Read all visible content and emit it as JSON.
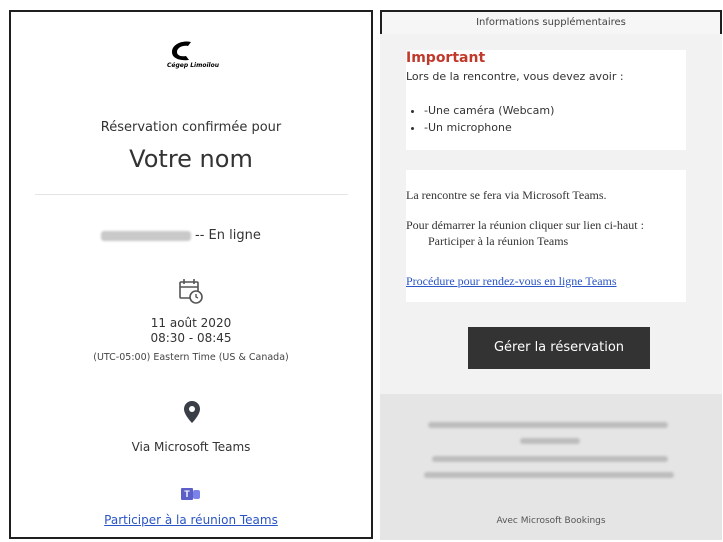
{
  "left": {
    "logo_text": "Cégep Limoilou",
    "confirm_label": "Réservation confirmée pour",
    "name": "Votre nom",
    "service_suffix": "-- En ligne",
    "date": "11 août 2020",
    "time": "08:30 - 08:45",
    "timezone": "(UTC-05:00) Eastern Time (US & Canada)",
    "location": "Via Microsoft Teams",
    "join_link": "Participer à la réunion Teams",
    "icons": [
      "calendar-clock-icon",
      "location-pin-icon",
      "teams-icon"
    ]
  },
  "right": {
    "header": "Informations supplémentaires",
    "important": "Important",
    "must_have": "Lors de la rencontre, vous devez avoir :",
    "items": [
      "-Une caméra (Webcam)",
      "-Un microphone"
    ],
    "via_teams": "La rencontre se fera via Microsoft Teams.",
    "to_start": "Pour démarrer la réunion cliquer sur lien ci-haut :",
    "to_start_link": "Participer à la réunion Teams",
    "procedure_link": "Procédure pour rendez-vous en ligne Teams",
    "manage_button": "Gérer la réservation",
    "powered_by": "Avec Microsoft Bookings"
  },
  "colors": {
    "link": "#2a55c4",
    "important": "#c0392b",
    "button": "#333333"
  }
}
